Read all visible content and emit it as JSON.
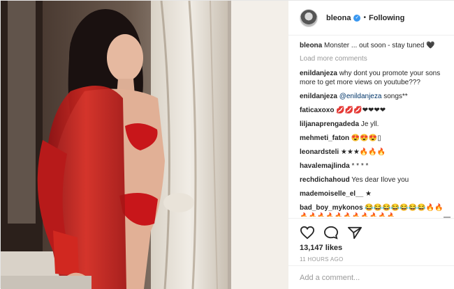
{
  "post": {
    "username": "bleona",
    "following_label": "Following",
    "caption": {
      "user": "bleona",
      "text": "Monster ... out soon - stay tuned 🖤"
    },
    "load_more": "Load more comments",
    "comments": [
      {
        "user": "enildanjeza",
        "text": "why dont you promote your sons more to get more views on youtube???"
      },
      {
        "user": "enildanjeza",
        "mention": "@enildanjeza",
        "text": " songs**"
      },
      {
        "user": "faticaxoxo",
        "text": "💋💋💋❤❤❤❤"
      },
      {
        "user": "liljanaprengadeda",
        "text": "Je yll."
      },
      {
        "user": "mehmeti_faton",
        "text": "😍😍😍▯"
      },
      {
        "user": "leonardsteli",
        "text": "★★★🔥🔥🔥"
      },
      {
        "user": "havalemajlinda",
        "text": "* * * *"
      },
      {
        "user": "rechdichahoud",
        "text": "Yes dear Ilove you"
      },
      {
        "user": "mademoiselle_el__",
        "text": "★"
      },
      {
        "user": "bad_boy_mykonos",
        "text": "😂😂😂😂😂😂😂🔥🔥🔥🔥🔥🔥🔥🔥🔥🔥🔥🔥🔥"
      }
    ],
    "likes": "13,147 likes",
    "time_ago": "11 HOURS AGO",
    "add_comment_placeholder": "Add a comment..."
  },
  "icons": [
    "heart-icon",
    "comment-icon",
    "share-icon"
  ],
  "colors": {
    "accent": "#3897f0",
    "muted": "#999999",
    "link": "#003569"
  }
}
